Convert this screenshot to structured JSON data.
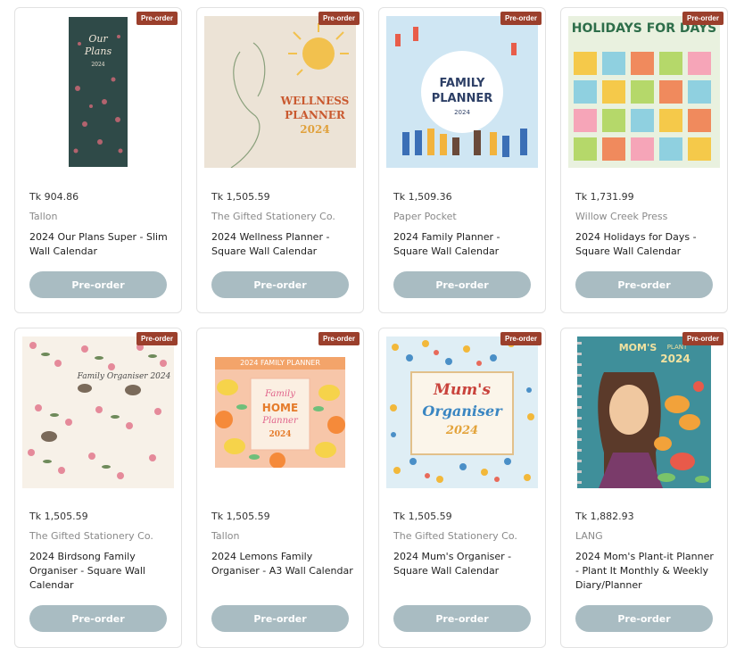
{
  "badge": "Pre-order",
  "products": [
    {
      "price": "Tk 904.86",
      "brand": "Tallon",
      "title": "2024 Our Plans Super - Slim Wall Calendar",
      "button": "Pre-order",
      "cover": {
        "line1": "Our",
        "line2": "Plans",
        "line3": "2024"
      }
    },
    {
      "price": "Tk 1,505.59",
      "brand": "The Gifted Stationery Co.",
      "title": "2024 Wellness Planner - Square Wall Calendar",
      "button": "Pre-order",
      "cover": {
        "line1": "WELLNESS",
        "line2": "PLANNER",
        "line3": "2024"
      }
    },
    {
      "price": "Tk 1,509.36",
      "brand": "Paper Pocket",
      "title": "2024 Family Planner - Square Wall Calendar",
      "button": "Pre-order",
      "cover": {
        "line1": "FAMILY",
        "line2": "PLANNER",
        "line3": "2024"
      }
    },
    {
      "price": "Tk 1,731.99",
      "brand": "Willow Creek Press",
      "title": "2024 Holidays for Days - Square Wall Calendar",
      "button": "Pre-order",
      "cover": {
        "line1": "HOLIDAYS FOR DAYS"
      }
    },
    {
      "price": "Tk 1,505.59",
      "brand": "The Gifted Stationery Co.",
      "title": "2024 Birdsong Family Organiser - Square Wall Calendar",
      "button": "Pre-order",
      "cover": {
        "line1": "Family Organiser 2024"
      }
    },
    {
      "price": "Tk 1,505.59",
      "brand": "Tallon",
      "title": "2024 Lemons Family Organiser - A3 Wall Calendar",
      "button": "Pre-order",
      "cover": {
        "line1": "2024 FAMILY PLANNER",
        "line2": "Family",
        "line3": "HOME",
        "line4": "Planner",
        "line5": "2024"
      }
    },
    {
      "price": "Tk 1,505.59",
      "brand": "The Gifted Stationery Co.",
      "title": "2024 Mum's Organiser - Square Wall Calendar",
      "button": "Pre-order",
      "cover": {
        "line1": "Mum's",
        "line2": "Organiser",
        "line3": "2024"
      }
    },
    {
      "price": "Tk 1,882.93",
      "brand": "LANG",
      "title": "2024 Mom's Plant-it Planner - Plant It Monthly & Weekly Diary/Planner",
      "button": "Pre-order",
      "cover": {
        "line1": "MOM'S",
        "line2": "PLANT",
        "line3": "2024"
      }
    }
  ]
}
